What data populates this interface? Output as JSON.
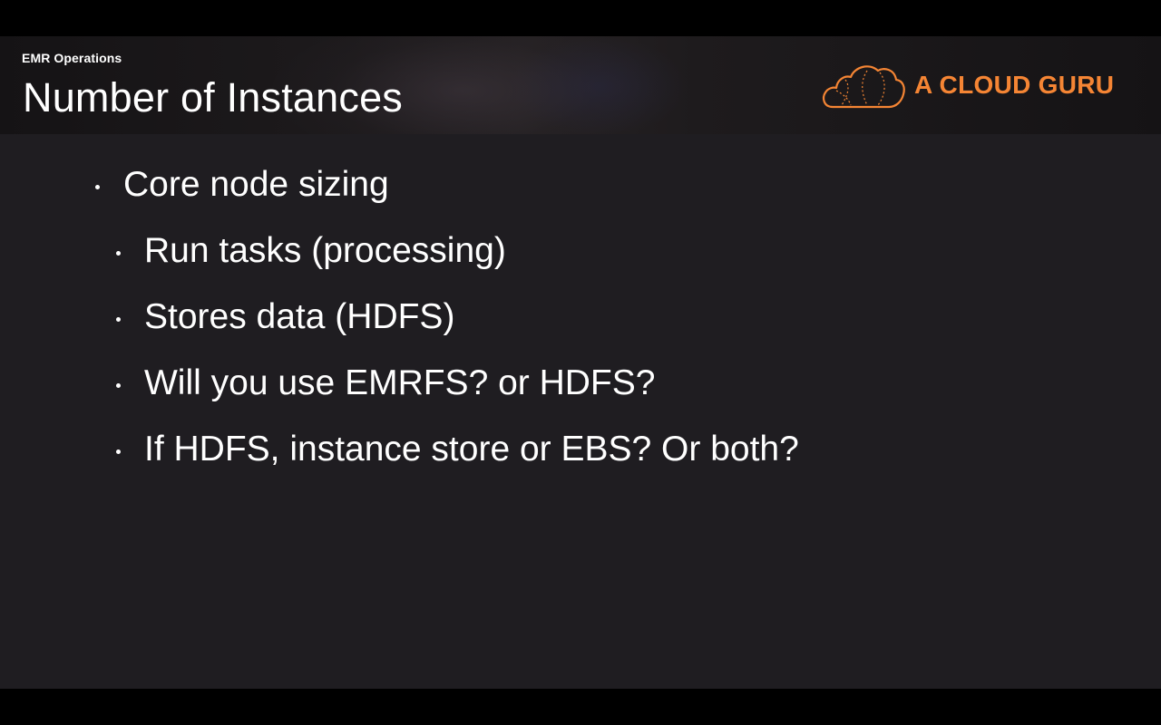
{
  "slide": {
    "section": "EMR Operations",
    "title": "Number of Instances",
    "brand": {
      "name": "A CLOUD GURU",
      "color": "#f58534",
      "icon": "cloud-logo-icon"
    },
    "background_color": "#1f1d21",
    "bullets": [
      {
        "level": 1,
        "text": "Core node sizing"
      },
      {
        "level": 2,
        "text": "Run tasks (processing)"
      },
      {
        "level": 2,
        "text": "Stores data (HDFS)"
      },
      {
        "level": 2,
        "text": "Will you use EMRFS? or HDFS?"
      },
      {
        "level": 2,
        "text": "If HDFS, instance store or EBS? Or both?"
      }
    ]
  }
}
